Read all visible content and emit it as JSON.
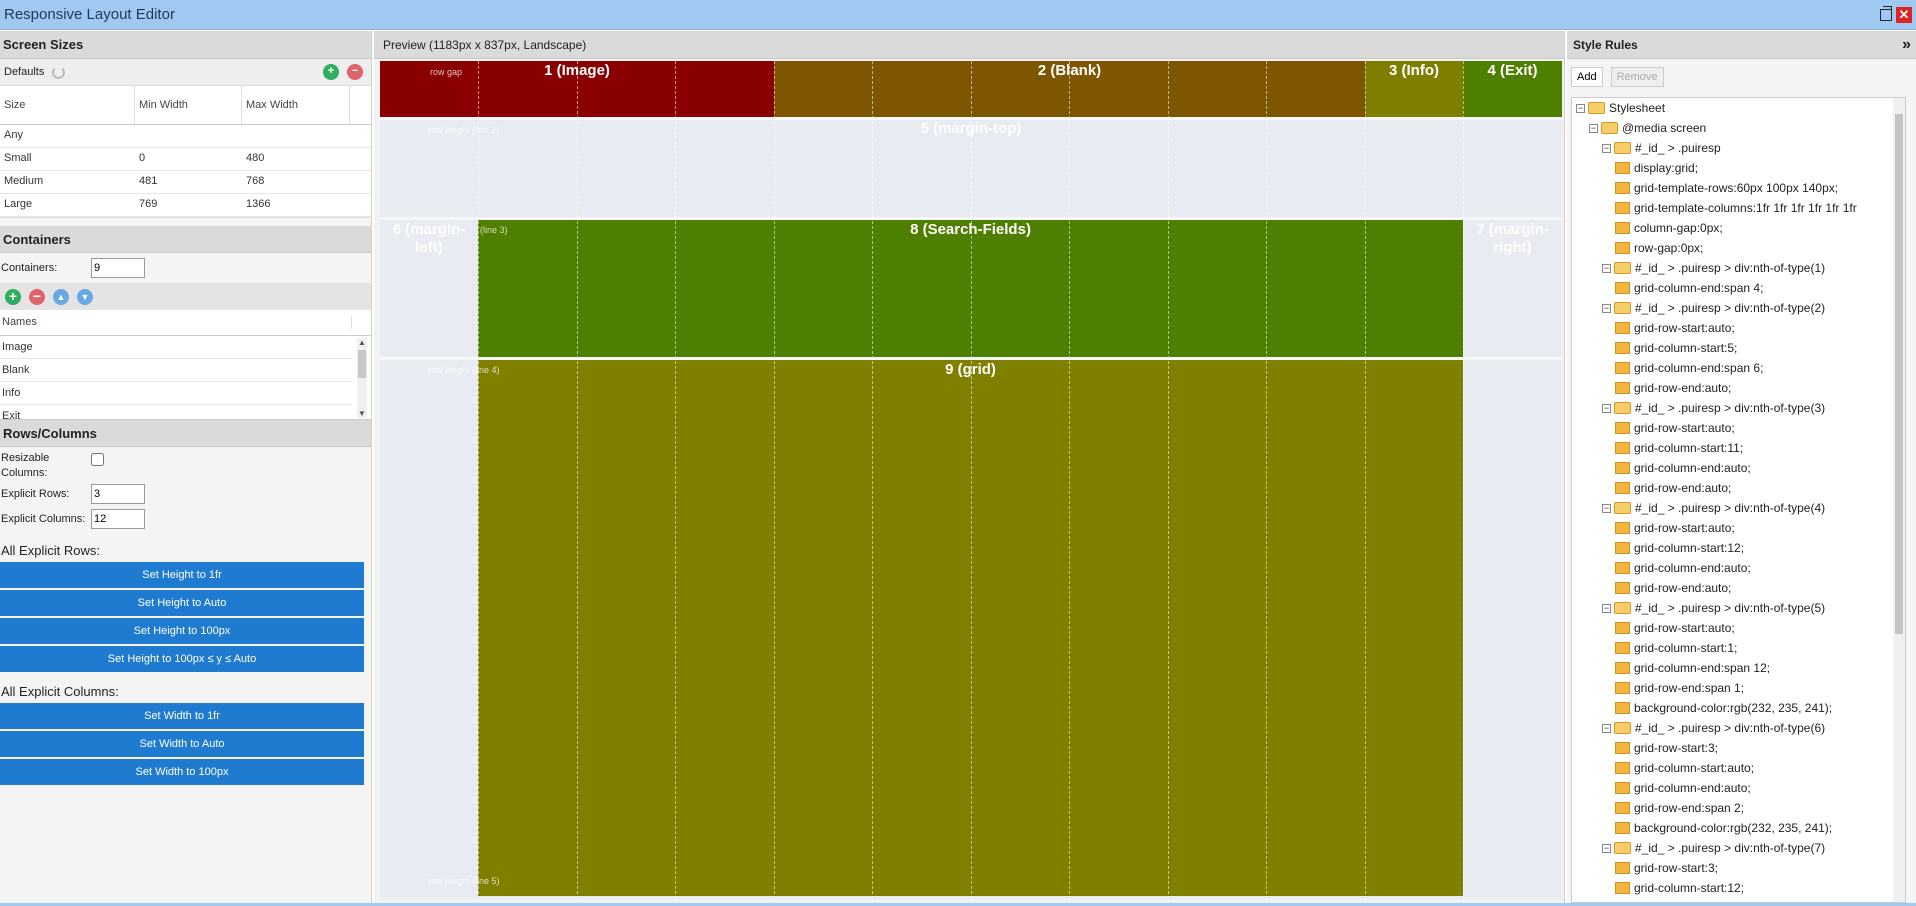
{
  "window": {
    "title": "Responsive Layout Editor",
    "close": "✕"
  },
  "screen_sizes": {
    "title": "Screen Sizes",
    "defaults_label": "Defaults",
    "columns": [
      "Size",
      "Min Width",
      "Max Width"
    ],
    "rows": [
      [
        "Any",
        "",
        ""
      ],
      [
        "Small",
        "0",
        "480"
      ],
      [
        "Medium",
        "481",
        "768"
      ],
      [
        "Large",
        "769",
        "1366"
      ]
    ]
  },
  "containers": {
    "title": "Containers",
    "count_label": "Containers:",
    "count_value": "9",
    "names_header": "Names",
    "names": [
      "Image",
      "Blank",
      "Info",
      "Exit",
      "margin-top"
    ]
  },
  "rows_columns": {
    "title": "Rows/Columns",
    "resizable_label": "Resizable Columns:",
    "explicit_rows_label": "Explicit Rows:",
    "explicit_rows_value": "3",
    "explicit_cols_label": "Explicit Columns:",
    "explicit_cols_value": "12",
    "all_rows_label": "All Explicit Rows:",
    "row_buttons": [
      "Set Height to 1fr",
      "Set Height to Auto",
      "Set Height to 100px",
      "Set Height to 100px ≤ y ≤ Auto"
    ],
    "all_cols_label": "All Explicit Columns:",
    "col_buttons": [
      "Set Width to 1fr",
      "Set Width to Auto",
      "Set Width to 100px"
    ]
  },
  "preview": {
    "title": "Preview (1183px x 837px, Landscape)",
    "cells": [
      "1 (Image)",
      "2 (Blank)",
      "3 (Info)",
      "4 (Exit)",
      "5 (margin-top)",
      "6 (margin-left)",
      "7 (margin-right)",
      "8 (Search-Fields)",
      "9 (grid)"
    ],
    "labels": [
      "row gap",
      "row height (line 2)",
      "(line 3)",
      "row height (line 4)",
      "row height (line 5)"
    ],
    "colors": {
      "image": "#8a0000",
      "blank": "#7e5500",
      "info": "#7e7f00",
      "exit": "#4f7f00",
      "search": "#4f7f00",
      "grid": "#7f7f00",
      "margin": "#e8ebf1"
    }
  },
  "style_rules": {
    "title": "Style Rules",
    "collapse": "»",
    "add": "Add",
    "remove": "Remove",
    "tree": [
      {
        "t": "Stylesheet",
        "lvl": 0,
        "kind": "folder"
      },
      {
        "t": "@media screen",
        "lvl": 1,
        "kind": "folder"
      },
      {
        "t": "#_id_ > .puiresp",
        "lvl": 2,
        "kind": "folder"
      },
      {
        "t": "display:grid;",
        "lvl": 3,
        "kind": "doc"
      },
      {
        "t": "grid-template-rows:60px 100px 140px;",
        "lvl": 3,
        "kind": "doc"
      },
      {
        "t": "grid-template-columns:1fr 1fr 1fr 1fr 1fr 1fr",
        "lvl": 3,
        "kind": "doc"
      },
      {
        "t": "column-gap:0px;",
        "lvl": 3,
        "kind": "doc"
      },
      {
        "t": "row-gap:0px;",
        "lvl": 3,
        "kind": "doc"
      },
      {
        "t": "#_id_ > .puiresp > div:nth-of-type(1)",
        "lvl": 2,
        "kind": "folder"
      },
      {
        "t": "grid-column-end:span 4;",
        "lvl": 3,
        "kind": "doc"
      },
      {
        "t": "#_id_ > .puiresp > div:nth-of-type(2)",
        "lvl": 2,
        "kind": "folder"
      },
      {
        "t": "grid-row-start:auto;",
        "lvl": 3,
        "kind": "doc"
      },
      {
        "t": "grid-column-start:5;",
        "lvl": 3,
        "kind": "doc"
      },
      {
        "t": "grid-column-end:span 6;",
        "lvl": 3,
        "kind": "doc"
      },
      {
        "t": "grid-row-end:auto;",
        "lvl": 3,
        "kind": "doc"
      },
      {
        "t": "#_id_ > .puiresp > div:nth-of-type(3)",
        "lvl": 2,
        "kind": "folder"
      },
      {
        "t": "grid-row-start:auto;",
        "lvl": 3,
        "kind": "doc"
      },
      {
        "t": "grid-column-start:11;",
        "lvl": 3,
        "kind": "doc"
      },
      {
        "t": "grid-column-end:auto;",
        "lvl": 3,
        "kind": "doc"
      },
      {
        "t": "grid-row-end:auto;",
        "lvl": 3,
        "kind": "doc"
      },
      {
        "t": "#_id_ > .puiresp > div:nth-of-type(4)",
        "lvl": 2,
        "kind": "folder"
      },
      {
        "t": "grid-row-start:auto;",
        "lvl": 3,
        "kind": "doc"
      },
      {
        "t": "grid-column-start:12;",
        "lvl": 3,
        "kind": "doc"
      },
      {
        "t": "grid-column-end:auto;",
        "lvl": 3,
        "kind": "doc"
      },
      {
        "t": "grid-row-end:auto;",
        "lvl": 3,
        "kind": "doc"
      },
      {
        "t": "#_id_ > .puiresp > div:nth-of-type(5)",
        "lvl": 2,
        "kind": "folder"
      },
      {
        "t": "grid-row-start:auto;",
        "lvl": 3,
        "kind": "doc"
      },
      {
        "t": "grid-column-start:1;",
        "lvl": 3,
        "kind": "doc"
      },
      {
        "t": "grid-column-end:span 12;",
        "lvl": 3,
        "kind": "doc"
      },
      {
        "t": "grid-row-end:span 1;",
        "lvl": 3,
        "kind": "doc"
      },
      {
        "t": "background-color:rgb(232, 235, 241);",
        "lvl": 3,
        "kind": "doc"
      },
      {
        "t": "#_id_ > .puiresp > div:nth-of-type(6)",
        "lvl": 2,
        "kind": "folder"
      },
      {
        "t": "grid-row-start:3;",
        "lvl": 3,
        "kind": "doc"
      },
      {
        "t": "grid-column-start:auto;",
        "lvl": 3,
        "kind": "doc"
      },
      {
        "t": "grid-column-end:auto;",
        "lvl": 3,
        "kind": "doc"
      },
      {
        "t": "grid-row-end:span 2;",
        "lvl": 3,
        "kind": "doc"
      },
      {
        "t": "background-color:rgb(232, 235, 241);",
        "lvl": 3,
        "kind": "doc"
      },
      {
        "t": "#_id_ > .puiresp > div:nth-of-type(7)",
        "lvl": 2,
        "kind": "folder"
      },
      {
        "t": "grid-row-start:3;",
        "lvl": 3,
        "kind": "doc"
      },
      {
        "t": "grid-column-start:12;",
        "lvl": 3,
        "kind": "doc"
      }
    ]
  }
}
